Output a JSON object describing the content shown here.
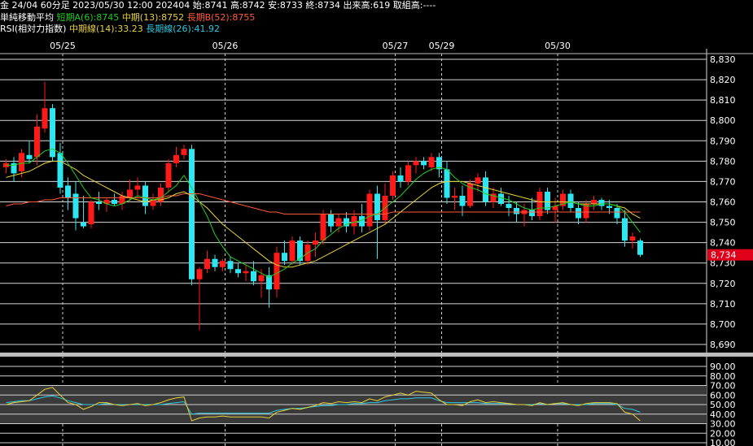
{
  "header": {
    "line1": "金 24/04 60分足 2023/05/30 12:00 202404 始:8741 高:8742 安:8733 終:8734 出来高:619 取組高:----",
    "sma_title": "単純移動平均",
    "sma_short": "短期A(6):8745",
    "sma_mid": "中期(13):8752",
    "sma_long": "長期B(52):8755",
    "rsi_title": "RSI(相対力指数)",
    "rsi_mid": "中期線(14):33.23",
    "rsi_long": "長期線(26):41.92"
  },
  "colors": {
    "up": "#ff1a1a",
    "down": "#2ee6f0",
    "sma_short": "#22cc22",
    "sma_mid": "#e8d23a",
    "sma_long": "#ff5a3a",
    "rsi_mid": "#e8d23a",
    "rsi_long": "#2ec9e0",
    "grid": "#ffffff",
    "price_tag_bg": "#e0001a"
  },
  "chart_data": [
    {
      "type": "candlestick",
      "x": [
        "05/25",
        "05/26",
        "05/27",
        "05/29",
        "05/30"
      ],
      "ylim": [
        8690,
        8830
      ],
      "yticks": [
        "8,830",
        "8,820",
        "8,810",
        "8,800",
        "8,790",
        "8,780",
        "8,770",
        "8,760",
        "8,750",
        "8,740",
        "8,730",
        "8,720",
        "8,710",
        "8,700",
        "8,690"
      ],
      "current_price_label": "8,734",
      "current_price": 8734,
      "candles": [
        [
          8777,
          8781,
          8774,
          8779
        ],
        [
          8779,
          8782,
          8770,
          8774
        ],
        [
          8775,
          8786,
          8772,
          8784
        ],
        [
          8783,
          8790,
          8779,
          8781
        ],
        [
          8782,
          8803,
          8778,
          8797
        ],
        [
          8796,
          8819,
          8794,
          8806
        ],
        [
          8806,
          8808,
          8780,
          8782
        ],
        [
          8784,
          8789,
          8764,
          8767
        ],
        [
          8768,
          8772,
          8756,
          8762
        ],
        [
          8764,
          8770,
          8746,
          8752
        ],
        [
          8750,
          8763,
          8747,
          8748
        ],
        [
          8749,
          8761,
          8747,
          8760
        ],
        [
          8760,
          8765,
          8756,
          8759
        ],
        [
          8759,
          8762,
          8755,
          8761
        ],
        [
          8761,
          8764,
          8758,
          8759
        ],
        [
          8759,
          8765,
          8756,
          8763
        ],
        [
          8762,
          8771,
          8760,
          8766
        ],
        [
          8766,
          8772,
          8762,
          8768
        ],
        [
          8768,
          8770,
          8754,
          8758
        ],
        [
          8758,
          8764,
          8756,
          8761
        ],
        [
          8760,
          8769,
          8758,
          8767
        ],
        [
          8767,
          8781,
          8765,
          8779
        ],
        [
          8779,
          8787,
          8777,
          8783
        ],
        [
          8783,
          8788,
          8781,
          8786
        ],
        [
          8786,
          8788,
          8719,
          8722
        ],
        [
          8722,
          8728,
          8697,
          8727
        ],
        [
          8727,
          8736,
          8725,
          8732
        ],
        [
          8732,
          8734,
          8726,
          8728
        ],
        [
          8728,
          8732,
          8726,
          8731
        ],
        [
          8731,
          8733,
          8725,
          8727
        ],
        [
          8727,
          8730,
          8723,
          8725
        ],
        [
          8725,
          8729,
          8721,
          8726
        ],
        [
          8726,
          8731,
          8719,
          8721
        ],
        [
          8721,
          8727,
          8713,
          8724
        ],
        [
          8724,
          8728,
          8708,
          8717
        ],
        [
          8717,
          8738,
          8713,
          8735
        ],
        [
          8735,
          8741,
          8729,
          8731
        ],
        [
          8731,
          8743,
          8729,
          8741
        ],
        [
          8741,
          8743,
          8729,
          8731
        ],
        [
          8731,
          8741,
          8729,
          8739
        ],
        [
          8739,
          8745,
          8733,
          8741
        ],
        [
          8741,
          8756,
          8739,
          8754
        ],
        [
          8754,
          8756,
          8745,
          8748
        ],
        [
          8748,
          8754,
          8745,
          8752
        ],
        [
          8752,
          8755,
          8745,
          8748
        ],
        [
          8748,
          8756,
          8744,
          8753
        ],
        [
          8753,
          8759,
          8745,
          8748
        ],
        [
          8748,
          8766,
          8746,
          8764
        ],
        [
          8764,
          8768,
          8732,
          8751
        ],
        [
          8751,
          8769,
          8749,
          8763
        ],
        [
          8763,
          8775,
          8761,
          8773
        ],
        [
          8773,
          8777,
          8767,
          8770
        ],
        [
          8770,
          8780,
          8768,
          8778
        ],
        [
          8778,
          8782,
          8774,
          8780
        ],
        [
          8780,
          8782,
          8776,
          8778
        ],
        [
          8777,
          8784,
          8775,
          8782
        ],
        [
          8782,
          8784,
          8772,
          8776
        ],
        [
          8776,
          8780,
          8759,
          8762
        ],
        [
          8762,
          8767,
          8756,
          8763
        ],
        [
          8763,
          8768,
          8753,
          8758
        ],
        [
          8758,
          8771,
          8757,
          8769
        ],
        [
          8769,
          8774,
          8765,
          8772
        ],
        [
          8772,
          8775,
          8758,
          8760
        ],
        [
          8760,
          8767,
          8757,
          8764
        ],
        [
          8764,
          8767,
          8758,
          8759
        ],
        [
          8759,
          8763,
          8753,
          8757
        ],
        [
          8757,
          8760,
          8750,
          8754
        ],
        [
          8754,
          8759,
          8748,
          8756
        ],
        [
          8756,
          8762,
          8751,
          8753
        ],
        [
          8753,
          8767,
          8751,
          8765
        ],
        [
          8765,
          8767,
          8754,
          8756
        ],
        [
          8756,
          8762,
          8750,
          8758
        ],
        [
          8758,
          8766,
          8756,
          8764
        ],
        [
          8764,
          8766,
          8755,
          8757
        ],
        [
          8757,
          8760,
          8749,
          8752
        ],
        [
          8752,
          8761,
          8750,
          8759
        ],
        [
          8759,
          8763,
          8756,
          8761
        ],
        [
          8761,
          8762,
          8756,
          8758
        ],
        [
          8758,
          8761,
          8754,
          8757
        ],
        [
          8757,
          8759,
          8749,
          8752
        ],
        [
          8752,
          8756,
          8738,
          8741
        ],
        [
          8741,
          8745,
          8737,
          8743
        ],
        [
          8741,
          8742,
          8733,
          8734
        ]
      ],
      "sma_short": [
        8778,
        8778,
        8779,
        8779,
        8782,
        8785,
        8786,
        8784,
        8779,
        8773,
        8767,
        8762,
        8761,
        8759,
        8758,
        8759,
        8761,
        8763,
        8762,
        8761,
        8762,
        8765,
        8768,
        8773,
        8767,
        8760,
        8753,
        8744,
        8738,
        8733,
        8731,
        8729,
        8727,
        8725,
        8723,
        8725,
        8727,
        8730,
        8732,
        8735,
        8737,
        8741,
        8744,
        8747,
        8749,
        8750,
        8751,
        8753,
        8754,
        8757,
        8760,
        8763,
        8767,
        8771,
        8774,
        8776,
        8777,
        8776,
        8772,
        8769,
        8767,
        8766,
        8764,
        8763,
        8762,
        8761,
        8759,
        8757,
        8756,
        8757,
        8757,
        8758,
        8759,
        8760,
        8759,
        8758,
        8758,
        8759,
        8759,
        8758,
        8755,
        8750,
        8745
      ],
      "sma_mid": [
        8772,
        8773,
        8774,
        8775,
        8777,
        8779,
        8780,
        8780,
        8778,
        8776,
        8773,
        8771,
        8769,
        8767,
        8765,
        8763,
        8762,
        8761,
        8760,
        8761,
        8761,
        8762,
        8764,
        8765,
        8763,
        8760,
        8757,
        8753,
        8749,
        8746,
        8743,
        8740,
        8737,
        8734,
        8731,
        8729,
        8728,
        8728,
        8729,
        8730,
        8731,
        8733,
        8735,
        8737,
        8739,
        8741,
        8743,
        8745,
        8747,
        8749,
        8752,
        8755,
        8758,
        8761,
        8764,
        8767,
        8769,
        8770,
        8770,
        8770,
        8769,
        8768,
        8767,
        8766,
        8765,
        8764,
        8763,
        8762,
        8761,
        8760,
        8760,
        8760,
        8760,
        8760,
        8759,
        8759,
        8759,
        8759,
        8759,
        8758,
        8757,
        8754,
        8752
      ],
      "sma_long": [
        8758,
        8759,
        8759,
        8760,
        8760,
        8761,
        8761,
        8762,
        8762,
        8762,
        8762,
        8762,
        8762,
        8762,
        8762,
        8762,
        8762,
        8762,
        8762,
        8762,
        8762,
        8763,
        8763,
        8764,
        8764,
        8764,
        8763,
        8762,
        8761,
        8760,
        8759,
        8758,
        8757,
        8756,
        8755,
        8755,
        8754,
        8754,
        8754,
        8754,
        8754,
        8754,
        8754,
        8754,
        8754,
        8754,
        8754,
        8754,
        8754,
        8754,
        8755,
        8755,
        8755,
        8755,
        8755,
        8755,
        8755,
        8755,
        8755,
        8755,
        8755,
        8755,
        8755,
        8755,
        8755,
        8755,
        8755,
        8755,
        8755,
        8755,
        8755,
        8755,
        8755,
        8755,
        8755,
        8755,
        8755,
        8755,
        8755,
        8755,
        8755,
        8755,
        8755
      ]
    },
    {
      "type": "line",
      "title": "RSI(相対力指数)",
      "ylim": [
        10,
        90
      ],
      "yticks": [
        "90.00",
        "80.00",
        "70.00",
        "60.00",
        "50.00",
        "40.00",
        "30.00",
        "20.00",
        "10.00"
      ],
      "series": [
        {
          "name": "中期線(14)",
          "values": [
            50,
            52,
            53,
            54,
            60,
            66,
            68,
            60,
            52,
            50,
            45,
            48,
            52,
            52,
            50,
            49,
            50,
            51,
            49,
            50,
            52,
            55,
            57,
            58,
            33,
            36,
            37,
            37,
            38,
            37,
            37,
            37,
            37,
            37,
            36,
            42,
            44,
            46,
            45,
            47,
            49,
            52,
            51,
            53,
            52,
            53,
            52,
            56,
            54,
            58,
            60,
            62,
            60,
            64,
            63,
            62,
            55,
            50,
            50,
            49,
            53,
            55,
            52,
            53,
            52,
            51,
            50,
            50,
            49,
            52,
            50,
            51,
            52,
            50,
            49,
            51,
            52,
            52,
            52,
            51,
            42,
            40,
            33
          ]
        },
        {
          "name": "長期線(26)",
          "values": [
            52,
            53,
            54,
            54,
            56,
            58,
            59,
            57,
            54,
            52,
            50,
            50,
            50,
            51,
            50,
            50,
            50,
            50,
            50,
            50,
            50,
            51,
            52,
            53,
            40,
            41,
            41,
            41,
            41,
            41,
            41,
            41,
            41,
            41,
            41,
            44,
            45,
            46,
            46,
            47,
            48,
            49,
            49,
            50,
            50,
            51,
            51,
            52,
            52,
            54,
            55,
            56,
            56,
            57,
            57,
            57,
            54,
            52,
            52,
            52,
            52,
            52,
            51,
            51,
            51,
            51,
            50,
            50,
            50,
            51,
            50,
            51,
            51,
            50,
            50,
            50,
            51,
            51,
            51,
            50,
            46,
            45,
            42
          ]
        }
      ]
    }
  ]
}
